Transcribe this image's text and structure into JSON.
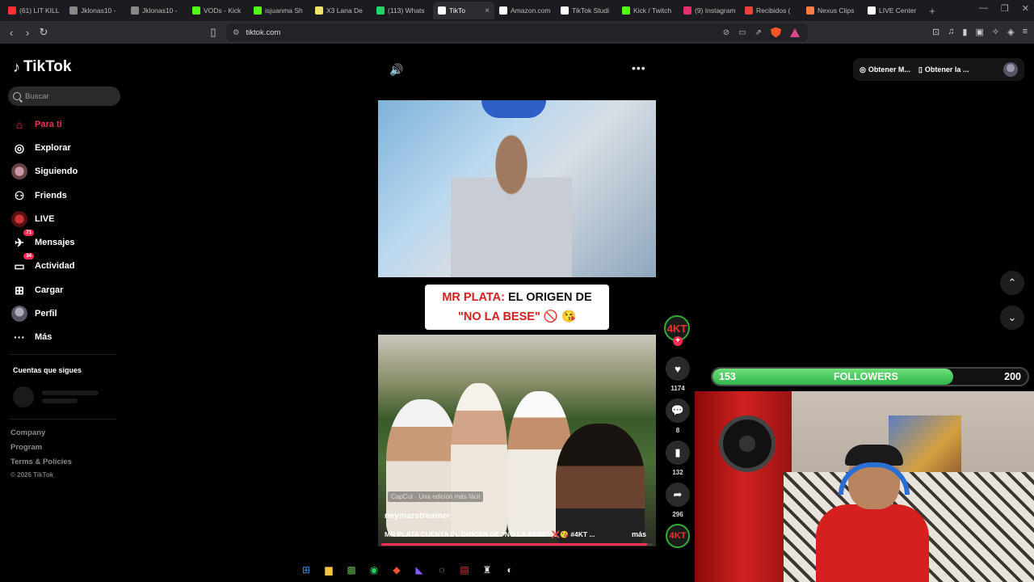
{
  "browser": {
    "tabs": [
      {
        "label": "(61) LIT KILL",
        "color": "#ff3030"
      },
      {
        "label": "Jklonas10 -",
        "color": "#888888"
      },
      {
        "label": "Jklonas10 -",
        "color": "#888888"
      },
      {
        "label": "VODs - Kick",
        "color": "#53fc18"
      },
      {
        "label": "isjuanma Sh",
        "color": "#53fc18"
      },
      {
        "label": "X3 Lana De",
        "color": "#f2e36b"
      },
      {
        "label": "(113) Whats",
        "color": "#25d366"
      },
      {
        "label": "TikTo",
        "color": "#ffffff",
        "active": true
      },
      {
        "label": "Amazon.com",
        "color": "#ffffff"
      },
      {
        "label": "TikTok Studi",
        "color": "#ffffff"
      },
      {
        "label": "Kick / Twitch",
        "color": "#53fc18"
      },
      {
        "label": "(9) Instagram",
        "color": "#e1306c"
      },
      {
        "label": "Recibidos (",
        "color": "#ea4335"
      },
      {
        "label": "Nexus Clips",
        "color": "#ff7a45"
      },
      {
        "label": "LIVE Center",
        "color": "#ffffff"
      }
    ],
    "tab_close": "×",
    "new_tab": "+",
    "url": "tiktok.com"
  },
  "sidebar": {
    "logo_text": "TikTok",
    "search_placeholder": "Buscar",
    "items": [
      {
        "label": "Para ti",
        "icon": "home-icon",
        "glyph": "⌂"
      },
      {
        "label": "Explorar",
        "icon": "compass-icon",
        "glyph": "◎"
      },
      {
        "label": "Siguiendo",
        "icon": "following-avatar-icon",
        "glyph": ""
      },
      {
        "label": "Friends",
        "icon": "friends-icon",
        "glyph": "⚇"
      },
      {
        "label": "LIVE",
        "icon": "live-avatar-icon",
        "glyph": ""
      },
      {
        "label": "Mensajes",
        "icon": "messages-icon",
        "glyph": "✈",
        "badge": "71"
      },
      {
        "label": "Actividad",
        "icon": "activity-icon",
        "glyph": "▭",
        "badge": "34"
      },
      {
        "label": "Cargar",
        "icon": "upload-icon",
        "glyph": "⊞"
      },
      {
        "label": "Perfil",
        "icon": "profile-avatar-icon",
        "glyph": ""
      },
      {
        "label": "Más",
        "icon": "more-dots-icon",
        "glyph": "···"
      }
    ],
    "following_title": "Cuentas que sigues",
    "footer": {
      "company": "Company",
      "program": "Program",
      "terms": "Terms & Policies",
      "copyright": "© 2026 TikTok"
    }
  },
  "video": {
    "caption_line1_red": "MR PLATA:",
    "caption_line1_rest": " EL ORIGEN DE",
    "caption_line2_red": "\"NO LA BESE\"",
    "caption_line2_emoji": " 🚫 😘",
    "capcut": "CapCut · Una edición más fácil",
    "username": "neymarstreamer",
    "description": "MR PLATA CUENTA EL ORIGEN DE \"NO LA BESE\" ❌😘 #4KT ...",
    "more": "más",
    "progress": 0.98
  },
  "actions": {
    "creator_badge": "4KT",
    "likes": "1174",
    "comments": "8",
    "saves": "132",
    "shares": "296"
  },
  "topright": {
    "pill1": "Obtener M...",
    "pill2": "Obtener la ..."
  },
  "overlay": {
    "followers_current": "153",
    "followers_label": "FOLLOWERS",
    "followers_goal": "200",
    "followers_progress": 0.765
  }
}
